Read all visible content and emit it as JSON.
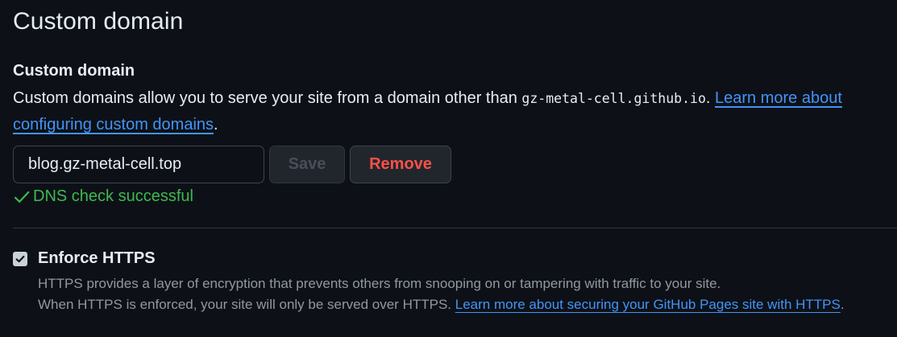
{
  "page_title": "Custom domain",
  "custom_domain": {
    "label": "Custom domain",
    "desc_before": "Custom domains allow you to serve your site from a domain other than ",
    "default_domain": "gz-metal-cell.github.io",
    "desc_after_code": ". ",
    "learn_more_link": "Learn more about configuring custom domains",
    "desc_end": ".",
    "input_value": "blog.gz-metal-cell.top",
    "save_label": "Save",
    "remove_label": "Remove",
    "dns_status": "DNS check successful"
  },
  "https": {
    "label": "Enforce HTTPS",
    "checked": true,
    "desc_line1": "HTTPS provides a layer of encryption that prevents others from snooping on or tampering with traffic to your site.",
    "desc_line2_before": "When HTTPS is enforced, your site will only be served over HTTPS. ",
    "learn_more_link": "Learn more about securing your GitHub Pages site with HTTPS",
    "desc_end": "."
  },
  "colors": {
    "background": "#0d1117",
    "link": "#4493f8",
    "success": "#3fb950",
    "danger": "#f85149",
    "muted": "#9198a1"
  },
  "icons": {
    "dns_status": "check-icon",
    "checkbox": "checkmark-icon"
  }
}
